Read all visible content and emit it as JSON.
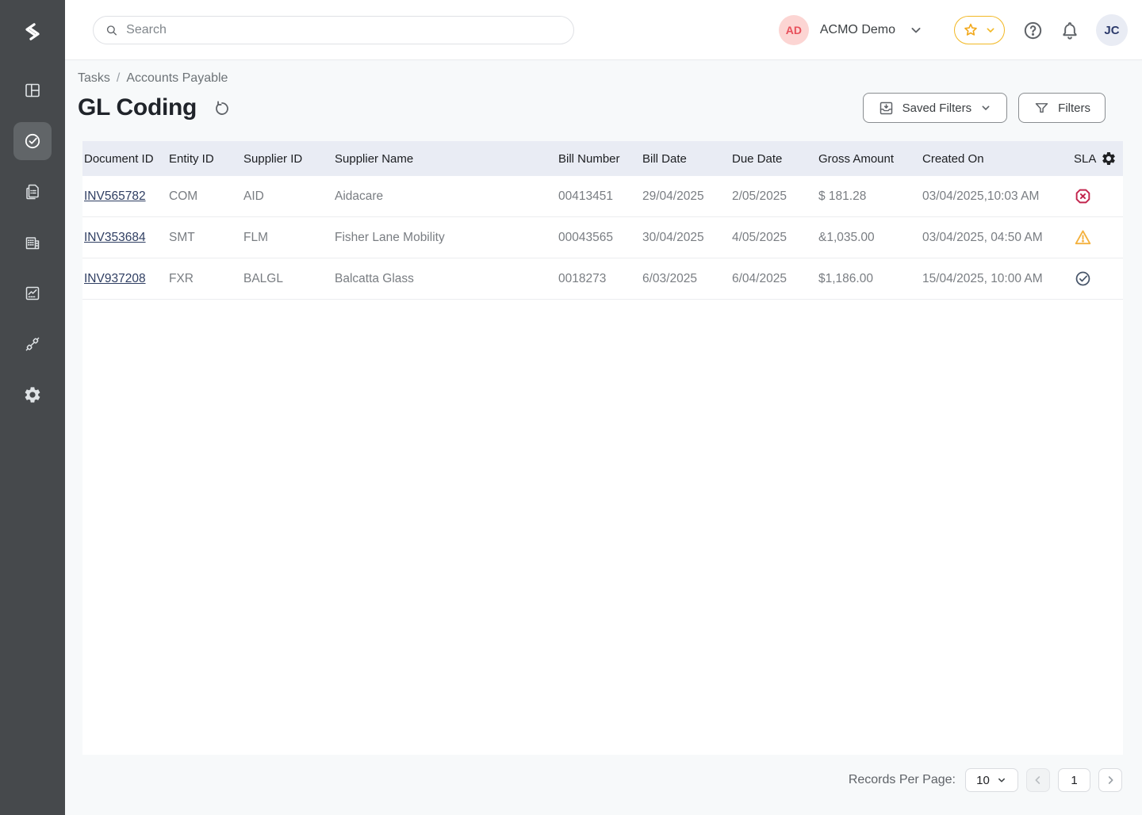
{
  "colors": {
    "sidebar_bg": "#46494c",
    "sidebar_active_bg": "#616568",
    "accent_gold": "#f2b824",
    "link": "#2f3e62",
    "table_header_bg": "#e9ecf4",
    "sla_breached": "#c2254d",
    "sla_warning": "#f4b13e",
    "sla_ok": "#475569"
  },
  "sidebar": {
    "logo_icon": "brand-logo",
    "items": [
      {
        "id": "dashboard",
        "icon": "dashboard-icon",
        "active": false
      },
      {
        "id": "tasks",
        "icon": "tasks-check-icon",
        "active": true
      },
      {
        "id": "documents",
        "icon": "documents-icon",
        "active": false
      },
      {
        "id": "organization",
        "icon": "building-icon",
        "active": false
      },
      {
        "id": "analytics",
        "icon": "analytics-icon",
        "active": false
      },
      {
        "id": "integrations",
        "icon": "plug-icon",
        "active": false
      },
      {
        "id": "settings",
        "icon": "gear-icon",
        "active": false
      }
    ]
  },
  "topbar": {
    "search_placeholder": "Search",
    "search_icon": "search-icon",
    "org": {
      "avatar_initials": "AD",
      "name": "ACMO Demo"
    },
    "favorites_icon": "star-icon",
    "help_icon": "help-icon",
    "notifications_icon": "bell-icon",
    "user": {
      "avatar_initials": "JC"
    }
  },
  "breadcrumb": {
    "items": [
      "Tasks",
      "Accounts Payable"
    ],
    "separator": "/"
  },
  "page": {
    "title": "GL Coding",
    "refresh_icon": "refresh-icon"
  },
  "toolbar": {
    "saved_filters": "Saved Filters",
    "filters": "Filters"
  },
  "table": {
    "columns": [
      "Document ID",
      "Entity ID",
      "Supplier ID",
      "Supplier Name",
      "Bill Number",
      "Bill Date",
      "Due Date",
      "Gross Amount",
      "Created On",
      "SLA"
    ],
    "settings_icon": "gear-icon",
    "rows": [
      {
        "document_id": "INV565782",
        "entity_id": "COM",
        "supplier_id": "AID",
        "supplier_name": "Aidacare",
        "bill_number": "00413451",
        "bill_date": "29/04/2025",
        "due_date": "2/05/2025",
        "gross_amount": "$ 181.28",
        "created_on": "03/04/2025,10:03 AM",
        "sla_status": "breached"
      },
      {
        "document_id": "INV353684",
        "entity_id": "SMT",
        "supplier_id": "FLM",
        "supplier_name": "Fisher Lane Mobility",
        "bill_number": "00043565",
        "bill_date": "30/04/2025",
        "due_date": "4/05/2025",
        "gross_amount": "&1,035.00",
        "created_on": "03/04/2025, 04:50 AM",
        "sla_status": "warning"
      },
      {
        "document_id": "INV937208",
        "entity_id": "FXR",
        "supplier_id": "BALGL",
        "supplier_name": "Balcatta Glass",
        "bill_number": "0018273",
        "bill_date": "6/03/2025",
        "due_date": "6/04/2025",
        "gross_amount": "$1,186.00",
        "created_on": "15/04/2025, 10:00 AM",
        "sla_status": "ok"
      }
    ]
  },
  "pagination": {
    "records_per_page_label": "Records Per Page:",
    "records_per_page": "10",
    "page": "1"
  }
}
